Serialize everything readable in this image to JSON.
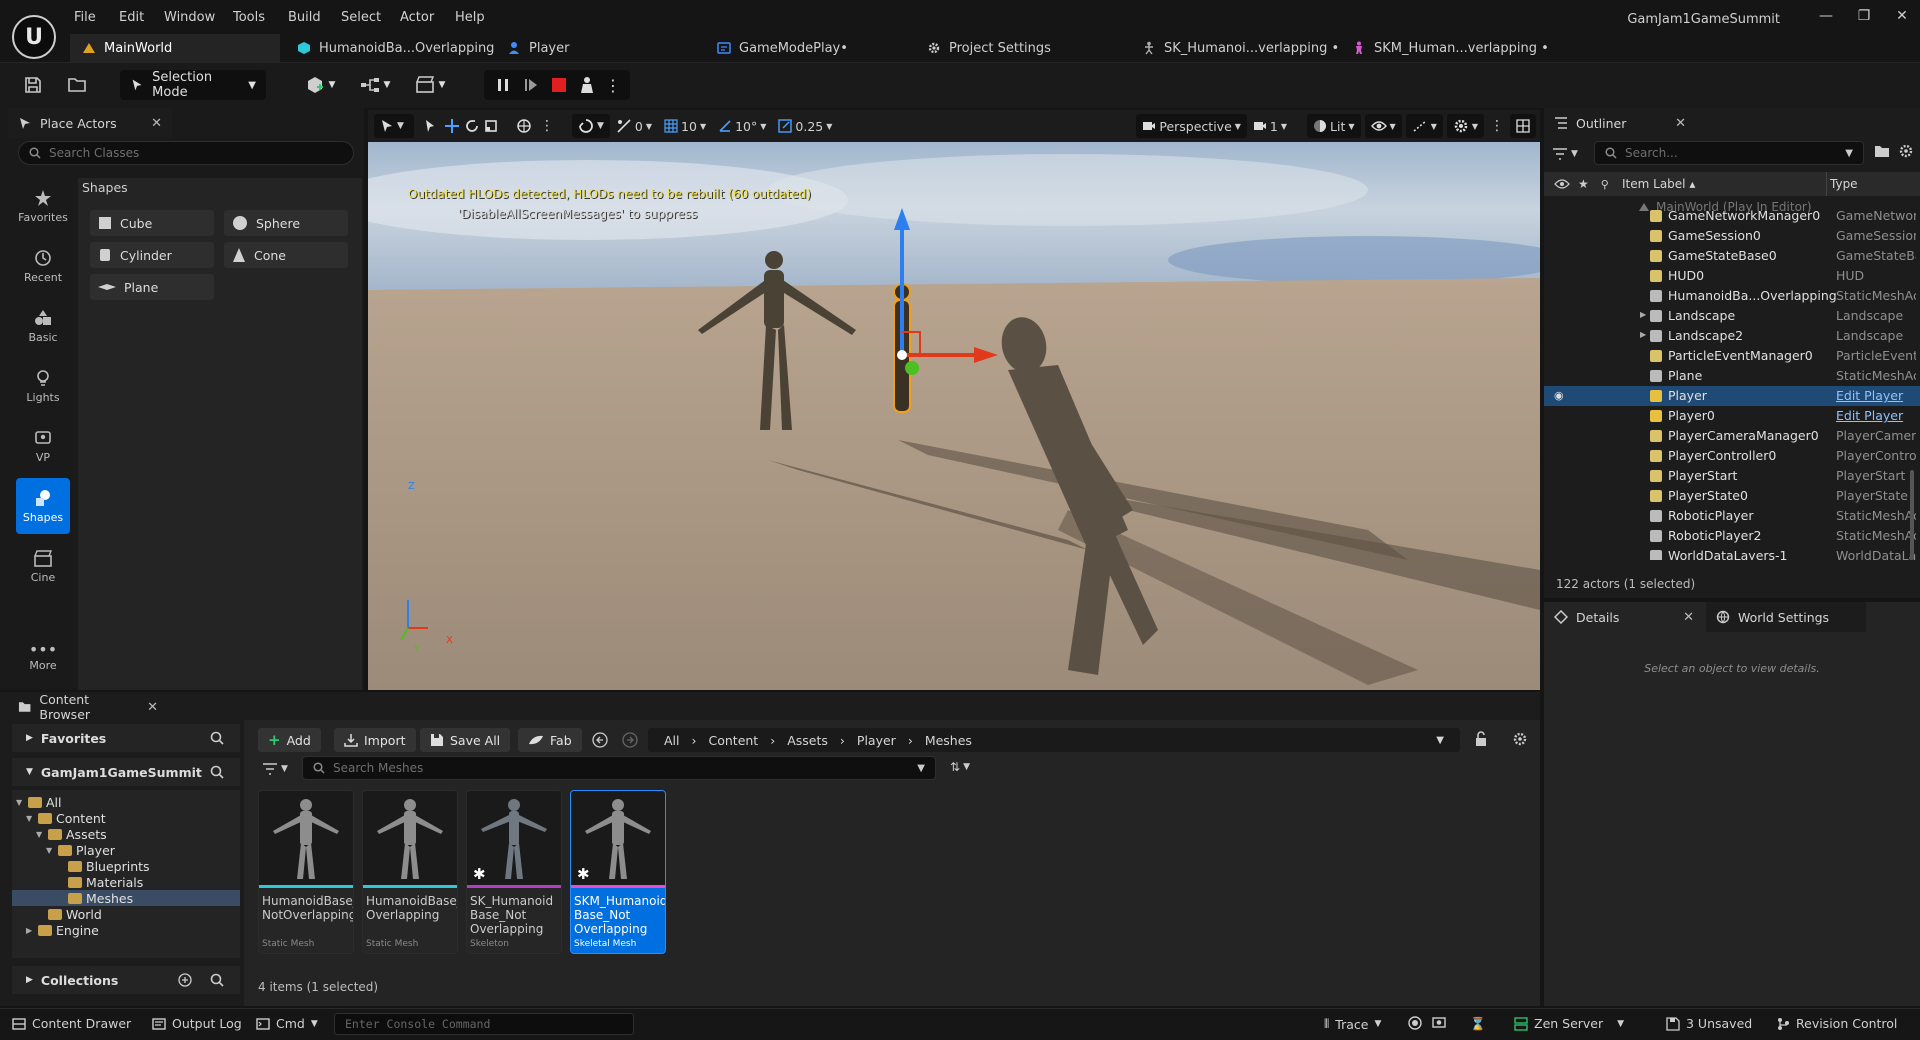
{
  "app": {
    "title": "GamJam1GameSummit",
    "menu": [
      "File",
      "Edit",
      "Window",
      "Tools",
      "Build",
      "Select",
      "Actor",
      "Help"
    ],
    "window_controls": [
      "minimize",
      "maximize",
      "close"
    ]
  },
  "document_tabs": [
    {
      "label": "MainWorld",
      "icon": "level-icon",
      "active": true
    },
    {
      "label": "HumanoidBa...Overlapping",
      "icon": "static-mesh-icon",
      "active": false
    },
    {
      "label": "Player",
      "icon": "blueprint-icon",
      "active": false
    },
    {
      "label": "GameModePlay•",
      "icon": "blueprint-icon",
      "active": false
    },
    {
      "label": "Project Settings",
      "icon": "gear-icon",
      "active": false
    },
    {
      "label": "SK_Humanoi...verlapping •",
      "icon": "skeleton-icon",
      "active": false
    },
    {
      "label": "SKM_Human...verlapping •",
      "icon": "skeletal-mesh-icon",
      "active": false
    }
  ],
  "toolbar": {
    "mode_label": "Selection Mode"
  },
  "place_actors": {
    "tab_label": "Place Actors",
    "search_placeholder": "Search Classes",
    "categories": [
      {
        "label": "Favorites",
        "icon": "star-icon",
        "active": false
      },
      {
        "label": "Recent",
        "icon": "clock-icon",
        "active": false
      },
      {
        "label": "Basic",
        "icon": "basic-icon",
        "active": false
      },
      {
        "label": "Lights",
        "icon": "light-icon",
        "active": false
      },
      {
        "label": "VP",
        "icon": "vp-icon",
        "active": false
      },
      {
        "label": "Shapes",
        "icon": "shapes-icon",
        "active": true
      },
      {
        "label": "Cine",
        "icon": "cine-icon",
        "active": false
      },
      {
        "label": "More",
        "icon": "more-icon",
        "active": false
      }
    ],
    "section_label": "Shapes",
    "shapes": [
      "Cube",
      "Sphere",
      "Cylinder",
      "Cone",
      "Plane"
    ]
  },
  "viewport": {
    "snap_rotation": "0",
    "grid": "10",
    "rotate_snap": "10°",
    "scale_snap": "0.25",
    "view_mode": "Perspective",
    "camera_speed": "1",
    "lighting": "Lit",
    "warning_line1": "Outdated HLODs detected, HLODs need to be rebuilt (60 outdated)",
    "warning_line2": "'DisableAllScreenMessages' to suppress",
    "axis_z": "Z",
    "axis_x": "X",
    "axis_y": "Y"
  },
  "outliner": {
    "tab_label": "Outliner",
    "search_placeholder": "Search...",
    "col_label": "Item Label ▴",
    "col_type": "Type",
    "world_row": "MainWorld (Play In Editor)",
    "rows": [
      {
        "label": "GameNetworkManager0",
        "type": "GameNetwor",
        "icon": "actor-icon",
        "selected": false
      },
      {
        "label": "GameSession0",
        "type": "GameSession",
        "icon": "actor-icon",
        "selected": false
      },
      {
        "label": "GameStateBase0",
        "type": "GameStateBa",
        "icon": "state-icon",
        "selected": false
      },
      {
        "label": "HUD0",
        "type": "HUD",
        "icon": "hud-icon",
        "selected": false
      },
      {
        "label": "HumanoidBa...Overlapping",
        "type": "StaticMeshAc",
        "icon": "mesh-icon",
        "selected": false
      },
      {
        "label": "Landscape",
        "type": "Landscape",
        "icon": "landscape-icon",
        "selected": false
      },
      {
        "label": "Landscape2",
        "type": "Landscape",
        "icon": "landscape-icon",
        "selected": false
      },
      {
        "label": "ParticleEventManager0",
        "type": "ParticleEvent",
        "icon": "actor-icon",
        "selected": false
      },
      {
        "label": "Plane",
        "type": "StaticMeshAc",
        "icon": "mesh-icon",
        "selected": false
      },
      {
        "label": "Player",
        "type": "Edit Player",
        "icon": "pawn-icon",
        "selected": true
      },
      {
        "label": "Player0",
        "type": "Edit Player",
        "icon": "pawn-icon",
        "selected": false
      },
      {
        "label": "PlayerCameraManager0",
        "type": "PlayerCamer",
        "icon": "actor-icon",
        "selected": false
      },
      {
        "label": "PlayerController0",
        "type": "PlayerControl",
        "icon": "gamepad-icon",
        "selected": false
      },
      {
        "label": "PlayerStart",
        "type": "PlayerStart",
        "icon": "actor-icon",
        "selected": false
      },
      {
        "label": "PlayerState0",
        "type": "PlayerState",
        "icon": "actor-icon",
        "selected": false
      },
      {
        "label": "RoboticPlayer",
        "type": "StaticMeshAc",
        "icon": "mesh-icon",
        "selected": false
      },
      {
        "label": "RoboticPlayer2",
        "type": "StaticMeshAc",
        "icon": "mesh-icon",
        "selected": false
      },
      {
        "label": "WorldDataLayers-1",
        "type": "WorldDataLay",
        "icon": "layers-icon",
        "selected": false
      }
    ],
    "status": "122 actors (1 selected)"
  },
  "details": {
    "tab_label": "Details",
    "world_settings_label": "World Settings",
    "empty_message": "Select an object to view details."
  },
  "content_browser": {
    "tab_label": "Content Browser",
    "favorites_label": "Favorites",
    "project_label": "GamJam1GameSummit",
    "collections_label": "Collections",
    "buttons": {
      "add": "Add",
      "import": "Import",
      "save_all": "Save All",
      "fab": "Fab"
    },
    "breadcrumb": [
      "All",
      "Content",
      "Assets",
      "Player",
      "Meshes"
    ],
    "search_placeholder": "Search Meshes",
    "tree": [
      {
        "label": "All",
        "depth": 0,
        "selected": false
      },
      {
        "label": "Content",
        "depth": 1,
        "selected": false
      },
      {
        "label": "Assets",
        "depth": 2,
        "selected": false
      },
      {
        "label": "Player",
        "depth": 3,
        "selected": false
      },
      {
        "label": "Blueprints",
        "depth": 4,
        "selected": false
      },
      {
        "label": "Materials",
        "depth": 4,
        "selected": false
      },
      {
        "label": "Meshes",
        "depth": 4,
        "selected": true
      },
      {
        "label": "World",
        "depth": 2,
        "selected": false
      },
      {
        "label": "Engine",
        "depth": 1,
        "selected": false
      }
    ],
    "assets": [
      {
        "name": "HumanoidBase_ NotOverlapping",
        "type": "Static Mesh",
        "bar": "#2ec8d8",
        "selected": false,
        "star": false
      },
      {
        "name": "HumanoidBase_ Overlapping",
        "type": "Static Mesh",
        "bar": "#2ec8d8",
        "selected": false,
        "star": false
      },
      {
        "name": "SK_Humanoid Base_Not Overlapping",
        "type": "Skeleton",
        "bar": "#b13ec3",
        "selected": false,
        "star": true
      },
      {
        "name": "SKM_Humanoid Base_Not Overlapping",
        "type": "Skeletal Mesh",
        "bar": "#e74cd2",
        "selected": true,
        "star": true
      }
    ],
    "items_status": "4 items (1 selected)"
  },
  "statusbar": {
    "content_drawer": "Content Drawer",
    "output_log": "Output Log",
    "cmd": "Cmd",
    "console_placeholder": "Enter Console Command",
    "trace": "Trace",
    "zen_server": "Zen Server",
    "unsaved": "3 Unsaved",
    "revision_control": "Revision Control"
  }
}
